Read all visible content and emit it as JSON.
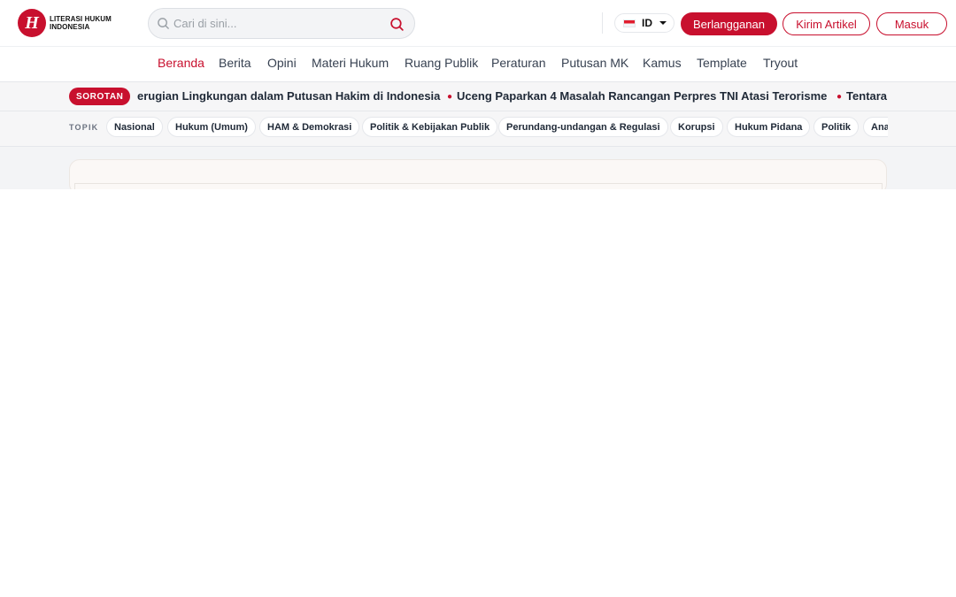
{
  "brand": {
    "logo_letter": "H",
    "logo_line1": "LITERASI HUKUM",
    "logo_line2": "INDONESIA"
  },
  "search": {
    "placeholder": "Cari di sini..."
  },
  "language": {
    "code": "ID"
  },
  "header_buttons": {
    "subscribe": "Berlangganan",
    "submit_article": "Kirim Artikel",
    "login": "Masuk"
  },
  "nav": {
    "items": [
      {
        "label": "Beranda",
        "active": true
      },
      {
        "label": "Berita"
      },
      {
        "label": "Opini"
      },
      {
        "label": "Materi Hukum"
      },
      {
        "label": "Ruang Publik"
      },
      {
        "label": "Peraturan"
      },
      {
        "label": "Putusan MK"
      },
      {
        "label": "Kamus"
      },
      {
        "label": "Template"
      },
      {
        "label": "Tryout"
      }
    ]
  },
  "sorotan": {
    "badge": "SOROTAN",
    "items": [
      "erugian Lingkungan dalam Putusan Hakim di Indonesia",
      "Uceng Paparkan 4 Masalah Rancangan Perpres TNI Atasi Terorisme",
      "Tentara"
    ]
  },
  "topik": {
    "label": "TOPIK",
    "chips": [
      "Nasional",
      "Hukum (Umum)",
      "HAM & Demokrasi",
      "Politik & Kebijakan Publik",
      "Perundang-undangan & Regulasi",
      "Korupsi",
      "Hukum Pidana",
      "Politik",
      "Ana"
    ]
  },
  "colors": {
    "accent": "#c8102e",
    "bar_bg": "#f6f6f7"
  }
}
